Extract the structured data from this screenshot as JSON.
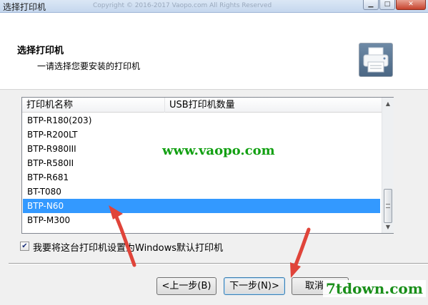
{
  "window": {
    "title": "选择打印机",
    "faded_text": "Copyright © 2016-2017 Vaopo.com All Rights Reserved"
  },
  "header": {
    "title": "选择打印机",
    "subtitle": "一请选择您要安装的打印机",
    "icon": "printer-icon"
  },
  "list": {
    "columns": [
      "打印机名称",
      "USB打印机数量"
    ],
    "rows": [
      "BTP-R180(203)",
      "BTP-R200LT",
      "BTP-R980III",
      "BTP-R580II",
      "BTP-R681",
      "BT-T080",
      "BTP-N60",
      "BTP-M300"
    ],
    "selected_index": 6
  },
  "watermark": "www.vaopo.com",
  "checkbox": {
    "label": "我要将这台打印机设置为Windows默认打印机",
    "checked": true
  },
  "buttons": {
    "back": "<上一步(B)",
    "next": "下一步(N)>",
    "cancel": "取消"
  },
  "brand_watermark": "7tdown.com",
  "colors": {
    "selection": "#3399ff",
    "watermark_green": "#12a012",
    "annotation_arrow": "#e0443a"
  }
}
